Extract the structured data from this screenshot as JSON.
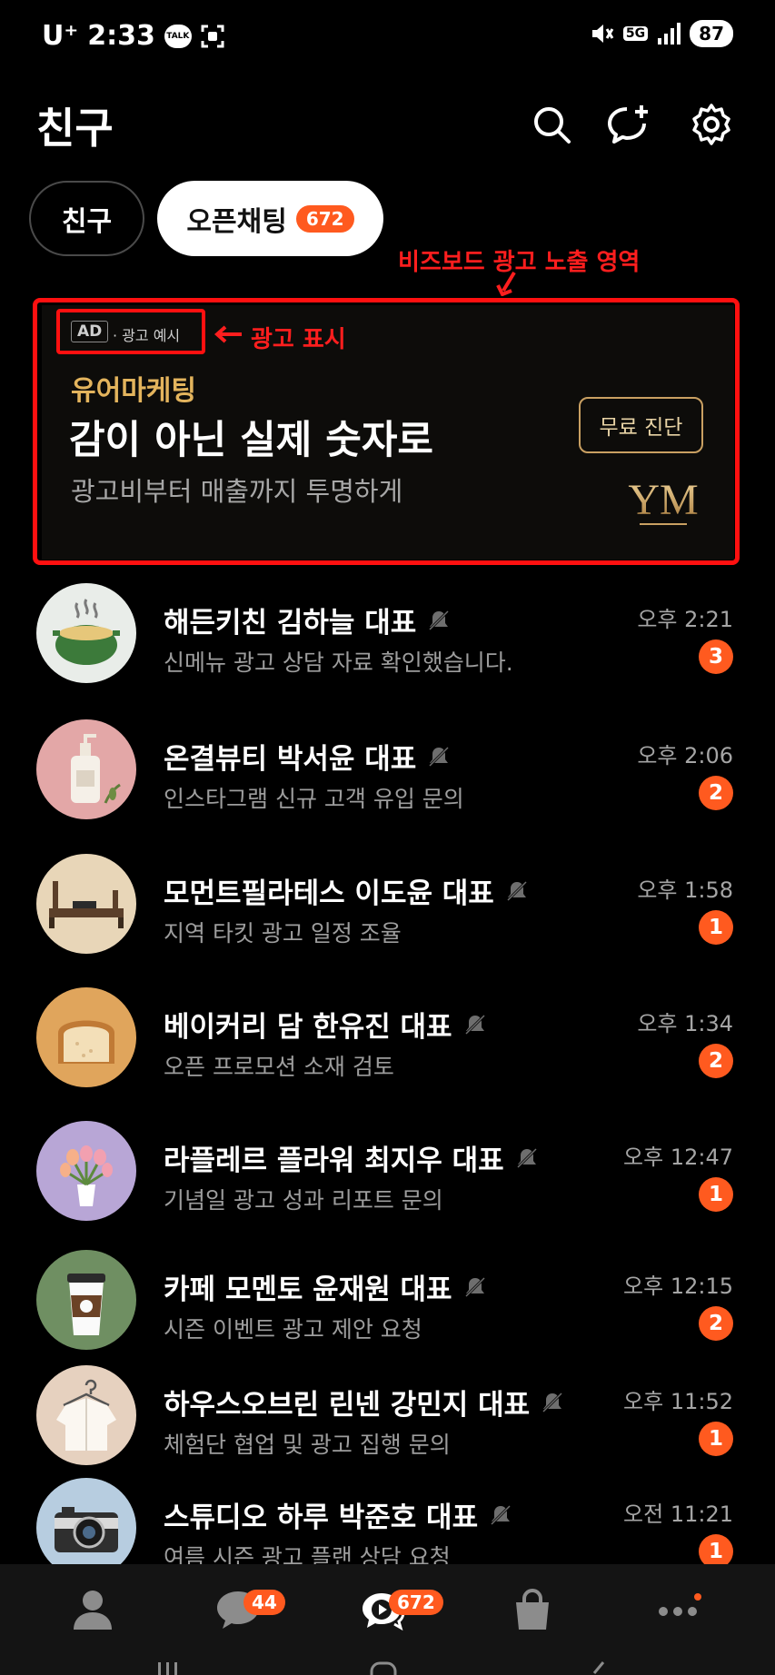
{
  "status_bar": {
    "carrier": "U⁺",
    "time": "2:33",
    "talk_icon_text": "TALK",
    "network": "5G",
    "battery": "87"
  },
  "header": {
    "title": "친구"
  },
  "tabs": [
    {
      "label": "친구"
    },
    {
      "label": "오픈채팅",
      "badge": "672"
    }
  ],
  "annotations": {
    "bizboard": "비즈보드 광고 노출 영역",
    "ad_label": "광고 표시"
  },
  "ad": {
    "badge": "AD",
    "sample": "· 광고 예시",
    "brand": "유어마케팅",
    "headline": "감이 아닌 실제 숫자로",
    "sub": "광고비부터 매출까지 투명하게",
    "cta": "무료 진단",
    "logo_text": "YM"
  },
  "chats": [
    {
      "name": "해든키친 김하늘 대표",
      "message": "신메뉴 광고 상담 자료 확인했습니다.",
      "time": "오후 2:21",
      "unread": "3",
      "avatar": "pot-icon"
    },
    {
      "name": "온결뷰티 박서윤 대표",
      "message": "인스타그램 신규 고객 유입 문의",
      "time": "오후 2:06",
      "unread": "2",
      "avatar": "lotion-bottle-icon"
    },
    {
      "name": "모먼트필라테스 이도윤 대표",
      "message": "지역 타킷 광고 일정 조율",
      "time": "오후 1:58",
      "unread": "1",
      "avatar": "reformer-icon"
    },
    {
      "name": "베이커리 담 한유진 대표",
      "message": "오픈 프로모션 소재 검토",
      "time": "오후 1:34",
      "unread": "2",
      "avatar": "bread-icon"
    },
    {
      "name": "라플레르 플라워 최지우 대표",
      "message": "기념일 광고 성과 리포트 문의",
      "time": "오후 12:47",
      "unread": "1",
      "avatar": "tulip-vase-icon"
    },
    {
      "name": "카페 모멘토 윤재원 대표",
      "message": "시즌 이벤트 광고 제안 요청",
      "time": "오후 12:15",
      "unread": "2",
      "avatar": "coffee-cup-icon"
    },
    {
      "name": "하우스오브린 린넨 강민지 대표",
      "message": "체험단 협업 및 광고 집행 문의",
      "time": "오후 11:52",
      "unread": "1",
      "avatar": "shirt-hanger-icon"
    },
    {
      "name": "스튜디오 하루 박준호 대표",
      "message": "여름 시즌 광고 플랜 상담 요청",
      "time": "오전 11:21",
      "unread": "1",
      "avatar": "camera-icon"
    }
  ],
  "bottom_nav": {
    "chats_badge": "44",
    "openchat_badge": "672"
  },
  "colors": {
    "accent": "#ff5a1f",
    "annotation": "#ff1010",
    "ad_gold": "#e3b45d"
  }
}
